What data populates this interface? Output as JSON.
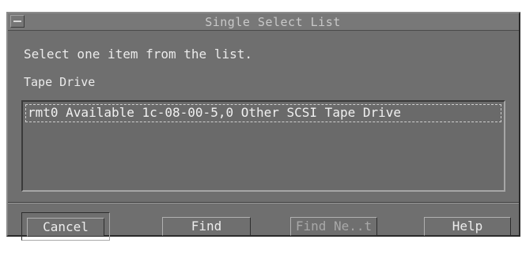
{
  "window": {
    "title": "Single Select List"
  },
  "prompt": "Select one item from the list.",
  "list": {
    "label": "Tape Drive",
    "items": [
      "rmt0 Available 1c-08-00-5,0 Other SCSI Tape Drive"
    ],
    "focused_index": 0
  },
  "buttons": {
    "cancel": "Cancel",
    "find": "Find",
    "find_next": "Find Ne..t",
    "help": "Help"
  },
  "state": {
    "find_next_enabled": false,
    "default_button": "cancel"
  },
  "colors": {
    "dialog_bg": "#6f6f6f",
    "text": "#ececec",
    "disabled_text": "#a8a8a8"
  }
}
